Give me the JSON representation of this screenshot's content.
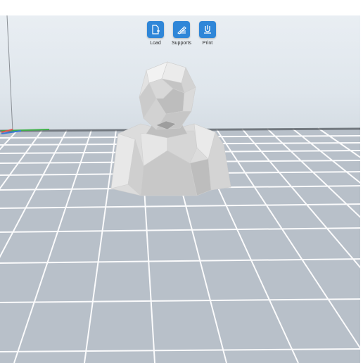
{
  "toolbar": {
    "buttons": [
      {
        "label": "Load",
        "icon": "load-file-icon"
      },
      {
        "label": "Supports",
        "icon": "supports-icon"
      },
      {
        "label": "Print",
        "icon": "print-icon"
      }
    ],
    "accent_color": "#2f86d8"
  },
  "viewport": {
    "background_color": "#dfe6ec",
    "grid_line_color": "#ffffff",
    "model_color": "#d9d9d9",
    "axis_colors": {
      "x": "#d9534f",
      "y": "#3fae49",
      "z": "#3a78d6"
    }
  }
}
